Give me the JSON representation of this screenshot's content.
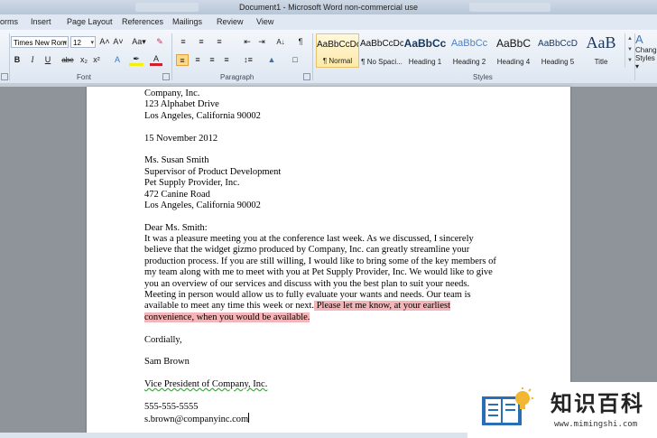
{
  "window": {
    "title": "Document1  -  Microsoft Word non-commercial use"
  },
  "tabs": [
    "orms",
    "Insert",
    "Page Layout",
    "References",
    "Mailings",
    "Review",
    "View"
  ],
  "font_group": {
    "font_name": "Times New Rom",
    "font_size": "12",
    "grow": "A˄",
    "shrink": "A˅",
    "change_case": "Aa▾",
    "bold": "B",
    "italic": "I",
    "underline": "U",
    "strike": "abe",
    "subscript": "x₂",
    "superscript": "x²",
    "label": "Font"
  },
  "paragraph_group": {
    "label": "Paragraph",
    "pilcrow": "¶"
  },
  "styles_group": {
    "label": "Styles",
    "styles": [
      {
        "preview": "AaBbCcDc",
        "name": "¶ Normal"
      },
      {
        "preview": "AaBbCcDc",
        "name": "¶ No Spaci..."
      },
      {
        "preview": "AaBbCc",
        "name": "Heading 1"
      },
      {
        "preview": "AaBbCc",
        "name": "Heading 2"
      },
      {
        "preview": "AaBbC",
        "name": "Heading 4"
      },
      {
        "preview": "AaBbCcD",
        "name": "Heading 5"
      },
      {
        "preview": "AaB",
        "name": "Title"
      }
    ],
    "change_styles": [
      "Change",
      "Styles ▾"
    ],
    "colors": {
      "heading": "#17365d",
      "accent": "#4f81bd"
    }
  },
  "document": {
    "sender": [
      "Company, Inc.",
      "123 Alphabet Drive",
      "Los Angeles, California 90002"
    ],
    "date": "15 November 2012",
    "recipient": [
      "Ms. Susan Smith",
      "Supervisor of Product Development",
      "Pet Supply Provider, Inc.",
      "472 Canine Road",
      "Los Angeles, California 90002"
    ],
    "salutation": "Dear Ms. Smith:",
    "body": [
      "It was a pleasure meeting you at the conference last week. As we discussed, I sincerely",
      "believe that the widget gizmo produced by Company, Inc. can greatly streamline  your",
      "production process. If you are still willing, I would like to bring some of the key members  of",
      "my team along with me to meet with you at Pet Supply Provider, Inc. We would like to give",
      "you an overview of our services and discuss with you the best plan to suit your needs.",
      "Meeting in person would allow us to fully evaluate your wants and needs. Our team is"
    ],
    "body_line7_plain": "available to meet any time this week or next.",
    "body_line7_highlight": " Please let me know, at your earliest",
    "body_line8_highlight": "convenience, when you would be available.",
    "closing": "Cordially,",
    "signer": "Sam Brown",
    "title": "Vice President of Company, Inc.",
    "phone": "555-555-5555",
    "email": "s.brown@companyinc.com",
    "highlight_color": "#f4b5b8"
  },
  "watermark": {
    "text": "知识百科",
    "url": "www.mimingshi.com"
  }
}
